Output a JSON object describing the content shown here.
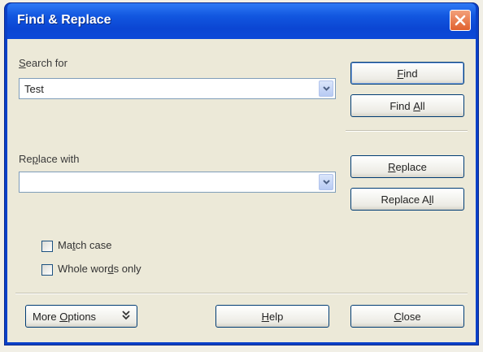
{
  "window": {
    "title": "Find & Replace",
    "close_icon": "close-icon"
  },
  "search": {
    "label_pre": "",
    "label_key": "S",
    "label_post": "earch for",
    "value": "Test"
  },
  "replace": {
    "label_pre": "Re",
    "label_key": "p",
    "label_post": "lace with",
    "value": ""
  },
  "buttons": {
    "find": {
      "pre": "",
      "key": "F",
      "post": "ind"
    },
    "find_all": {
      "pre": "Find ",
      "key": "A",
      "post": "ll"
    },
    "replace": {
      "pre": "",
      "key": "R",
      "post": "eplace"
    },
    "replace_all": {
      "pre": "Replace A",
      "key": "l",
      "post": "l"
    },
    "more_options": {
      "pre": "More ",
      "key": "O",
      "post": "ptions",
      "icon": "double-chevron-down-icon"
    },
    "help": {
      "pre": "",
      "key": "H",
      "post": "elp"
    },
    "close": {
      "pre": "",
      "key": "C",
      "post": "lose"
    }
  },
  "options": {
    "match_case": {
      "pre": "Ma",
      "key": "t",
      "post": "ch case",
      "checked": false
    },
    "whole_words": {
      "pre": "Whole wor",
      "key": "d",
      "post": "s only",
      "checked": false
    }
  },
  "colors": {
    "titlebar": "#0b46d3",
    "client_bg": "#ece9d8",
    "close_button": "#e0612f"
  }
}
